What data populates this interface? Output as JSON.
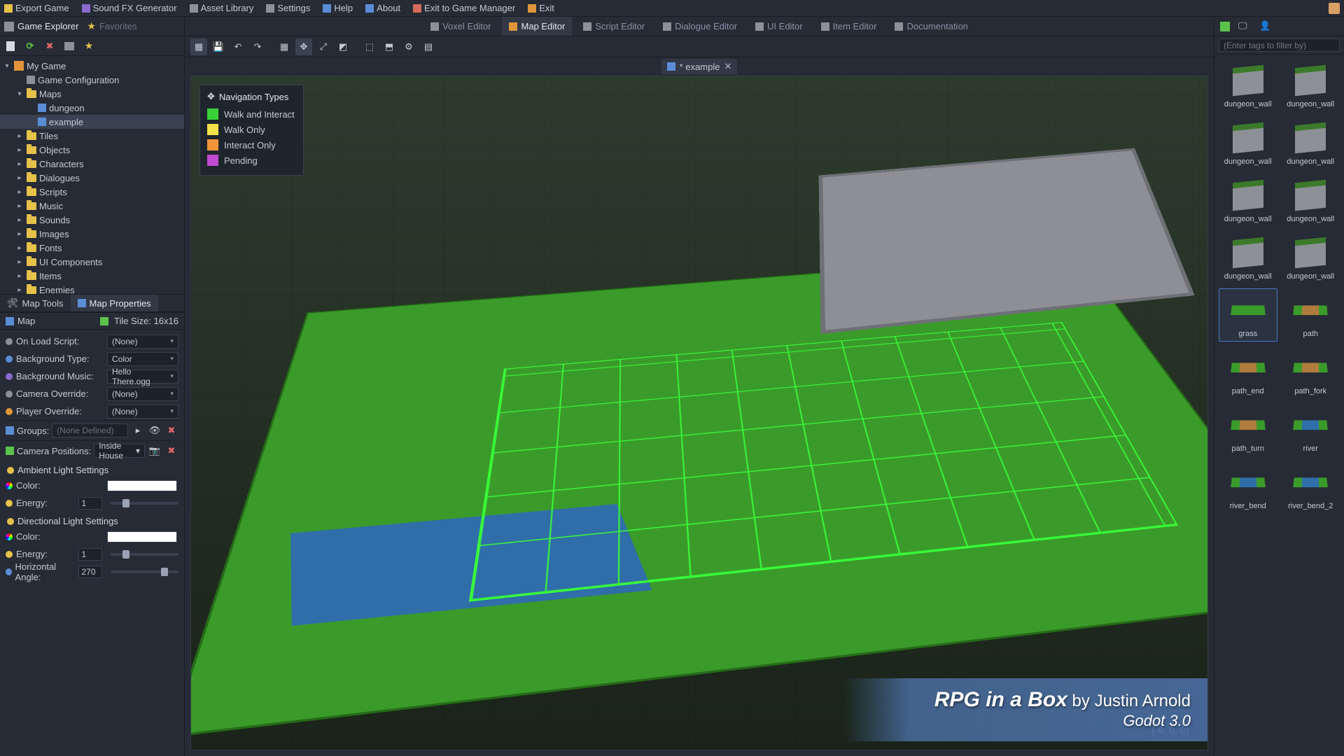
{
  "top_menu": {
    "items": [
      {
        "label": "Export Game",
        "icon": "box-icon",
        "color": "ic-yellow"
      },
      {
        "label": "Sound FX Generator",
        "icon": "speaker-icon",
        "color": "ic-purple"
      },
      {
        "label": "Asset Library",
        "icon": "cart-icon",
        "color": "ic-gray"
      },
      {
        "label": "Settings",
        "icon": "gear-icon",
        "color": "ic-gray"
      },
      {
        "label": "Help",
        "icon": "help-icon",
        "color": "ic-blue"
      },
      {
        "label": "About",
        "icon": "info-icon",
        "color": "ic-blue"
      },
      {
        "label": "Exit to Game Manager",
        "icon": "exit-icon",
        "color": "ic-red"
      },
      {
        "label": "Exit",
        "icon": "door-icon",
        "color": "ic-orange"
      }
    ]
  },
  "left": {
    "tabs": {
      "explorer": "Game Explorer",
      "favorites": "Favorites"
    },
    "tree": {
      "root": "My Game",
      "items": [
        {
          "label": "Game Configuration",
          "icon": "gear",
          "depth": 1
        },
        {
          "label": "Maps",
          "icon": "folder",
          "depth": 1,
          "expanded": true
        },
        {
          "label": "dungeon",
          "icon": "map",
          "depth": 2
        },
        {
          "label": "example",
          "icon": "map",
          "depth": 2,
          "selected": true
        },
        {
          "label": "Tiles",
          "icon": "folder",
          "depth": 1
        },
        {
          "label": "Objects",
          "icon": "folder",
          "depth": 1
        },
        {
          "label": "Characters",
          "icon": "folder",
          "depth": 1
        },
        {
          "label": "Dialogues",
          "icon": "folder",
          "depth": 1
        },
        {
          "label": "Scripts",
          "icon": "folder",
          "depth": 1
        },
        {
          "label": "Music",
          "icon": "folder",
          "depth": 1
        },
        {
          "label": "Sounds",
          "icon": "folder",
          "depth": 1
        },
        {
          "label": "Images",
          "icon": "folder",
          "depth": 1
        },
        {
          "label": "Fonts",
          "icon": "folder",
          "depth": 1
        },
        {
          "label": "UI Components",
          "icon": "folder",
          "depth": 1
        },
        {
          "label": "Items",
          "icon": "folder",
          "depth": 1
        },
        {
          "label": "Enemies",
          "icon": "folder",
          "depth": 1
        }
      ]
    },
    "prop_tabs": {
      "tools": "Map Tools",
      "props": "Map Properties"
    },
    "map_header": {
      "title": "Map",
      "tile_size": "Tile Size: 16x16"
    },
    "props": {
      "on_load": {
        "label": "On Load Script:",
        "value": "(None)"
      },
      "bg_type": {
        "label": "Background Type:",
        "value": "Color"
      },
      "bg_music": {
        "label": "Background Music:",
        "value": "Hello There.ogg"
      },
      "cam_ovr": {
        "label": "Camera Override:",
        "value": "(None)"
      },
      "ply_ovr": {
        "label": "Player Override:",
        "value": "(None)"
      }
    },
    "groups": {
      "label": "Groups:",
      "value": "(None Defined)"
    },
    "cam_pos": {
      "label": "Camera Positions:",
      "value": "Inside House"
    },
    "ambient": {
      "title": "Ambient Light Settings",
      "color_label": "Color:",
      "energy_label": "Energy:",
      "energy_value": "1"
    },
    "directional": {
      "title": "Directional Light Settings",
      "color_label": "Color:",
      "energy_label": "Energy:",
      "energy_value": "1",
      "hangle_label": "Horizontal Angle:",
      "hangle_value": "270"
    }
  },
  "center": {
    "editor_tabs": [
      {
        "label": "Voxel Editor",
        "icon": "cube-icon"
      },
      {
        "label": "Map Editor",
        "icon": "map-icon",
        "active": true
      },
      {
        "label": "Script Editor",
        "icon": "script-icon"
      },
      {
        "label": "Dialogue Editor",
        "icon": "chat-icon"
      },
      {
        "label": "UI Editor",
        "icon": "ui-icon"
      },
      {
        "label": "Item Editor",
        "icon": "item-icon"
      },
      {
        "label": "Documentation",
        "icon": "doc-icon"
      }
    ],
    "file_tab": {
      "label": "* example"
    },
    "legend": {
      "title": "Navigation Types",
      "rows": [
        {
          "label": "Walk and Interact",
          "color": "#38d238"
        },
        {
          "label": "Walk Only",
          "color": "#f2e24a"
        },
        {
          "label": "Interact Only",
          "color": "#f2953a"
        },
        {
          "label": "Pending",
          "color": "#c24ad2"
        }
      ]
    },
    "coord": "(-6, 0, 0)",
    "credit": {
      "line1_a": "RPG in a Box",
      "line1_b": " by Justin Arnold",
      "line2": "Godot 3.0"
    }
  },
  "right": {
    "filter_placeholder": "(Enter tags to filter by)",
    "tiles": [
      {
        "name": "dungeon_wall",
        "kind": "wall"
      },
      {
        "name": "dungeon_wall",
        "kind": "wall"
      },
      {
        "name": "dungeon_wall",
        "kind": "wall"
      },
      {
        "name": "dungeon_wall",
        "kind": "wall"
      },
      {
        "name": "dungeon_wall",
        "kind": "wall"
      },
      {
        "name": "dungeon_wall",
        "kind": "wall"
      },
      {
        "name": "dungeon_wall",
        "kind": "wall"
      },
      {
        "name": "dungeon_wall",
        "kind": "wall"
      },
      {
        "name": "grass",
        "kind": "grass",
        "selected": true
      },
      {
        "name": "path",
        "kind": "path"
      },
      {
        "name": "path_end",
        "kind": "path"
      },
      {
        "name": "path_fork",
        "kind": "path"
      },
      {
        "name": "path_turn",
        "kind": "path"
      },
      {
        "name": "river",
        "kind": "river"
      },
      {
        "name": "river_bend",
        "kind": "river"
      },
      {
        "name": "river_bend_2",
        "kind": "river"
      }
    ]
  }
}
